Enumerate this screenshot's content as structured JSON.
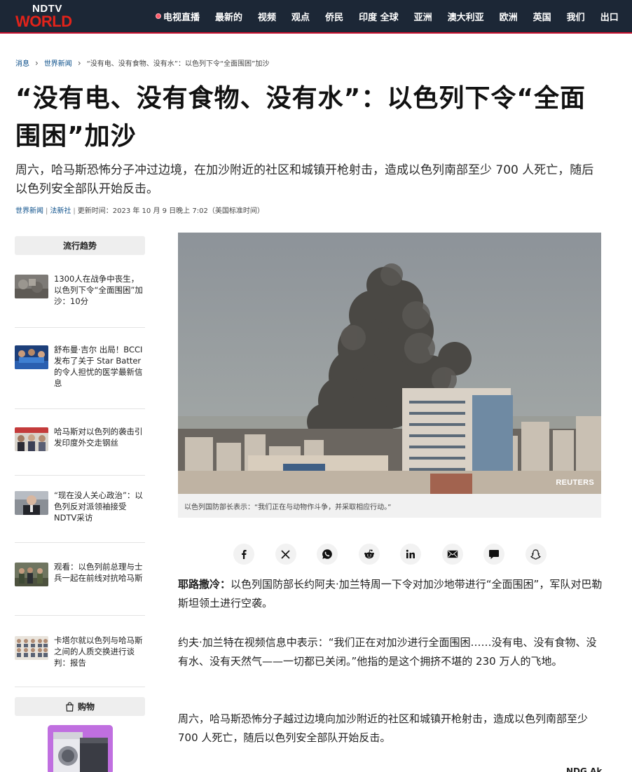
{
  "logo": {
    "top": "NDTV",
    "bottom": "WORLD"
  },
  "nav": {
    "live_label": "电视直播",
    "items": [
      "最新的",
      "视频",
      "观点",
      "侨民",
      "印度 全球",
      "亚洲",
      "澳大利亚",
      "欧洲",
      "英国",
      "我们",
      "出口"
    ]
  },
  "breadcrumb": {
    "home": "消息",
    "section": "世界新闻",
    "current": "“没有电、没有食物、没有水”：以色列下令“全面围困”加沙"
  },
  "article": {
    "headline": "“没有电、没有食物、没有水”：以色列下令“全面围困”加沙",
    "summary": "周六，哈马斯恐怖分子冲过边境，在加沙附近的社区和城镇开枪射击，造成以色列南部至少 700 人死亡，随后以色列安全部队开始反击。",
    "category": "世界新闻",
    "source": "法新社",
    "updated": "更新时间：2023 年 10 月 9 日晚上 7:02（美国标准时间）",
    "image_credit": "REUTERS",
    "image_caption": "以色列国防部长表示：“我们正在与动物作斗争，并采取相应行动。”",
    "paragraphs": [
      {
        "lead": "耶路撒冷：",
        "text": "以色列国防部长约阿夫·加兰特周一下令对加沙地带进行“全面围困”，军队对巴勒斯坦领土进行空袭。"
      },
      {
        "lead": "",
        "text": "约夫·加兰特在视频信息中表示：“我们正在对加沙进行全面围困……没有电、没有食物、没有水、没有天然气——一切都已关闭。”他指的是这个拥挤不堪的 230 万人的飞地。"
      },
      {
        "lead": "",
        "text": "周六，哈马斯恐怖分子越过边境向加沙附近的社区和城镇开枪射击，造成以色列南部至少 700 人死亡，随后以色列安全部队开始反击。"
      }
    ],
    "read_more": "NDG Ak"
  },
  "sidebar": {
    "trending_title": "流行趋势",
    "trending": [
      {
        "title": "1300人在战争中丧生，以色列下令“全面围困”加沙：10分"
      },
      {
        "title": "舒布曼·吉尔 出局！BCCI 发布了关于 Star Batter 的令人担忧的医学最新信息"
      },
      {
        "title": "哈马斯对以色列的袭击引发印度外交走钢丝"
      },
      {
        "title": "“现在没人关心政治”：以色列反对派领袖接受NDTV采访"
      },
      {
        "title": "观看：以色列前总理与士兵一起在前线对抗哈马斯"
      },
      {
        "title": "卡塔尔就以色列与哈马斯之间的人质交换进行谈判：报告"
      }
    ],
    "shop_title": "购物"
  },
  "share": [
    "facebook-icon",
    "x-icon",
    "whatsapp-icon",
    "reddit-icon",
    "linkedin-icon",
    "email-icon",
    "comment-icon",
    "snapchat-icon"
  ],
  "colors": {
    "nav_bg": "#1c2736",
    "brand_red": "#e2231a",
    "link_blue": "#0b4f8a"
  }
}
